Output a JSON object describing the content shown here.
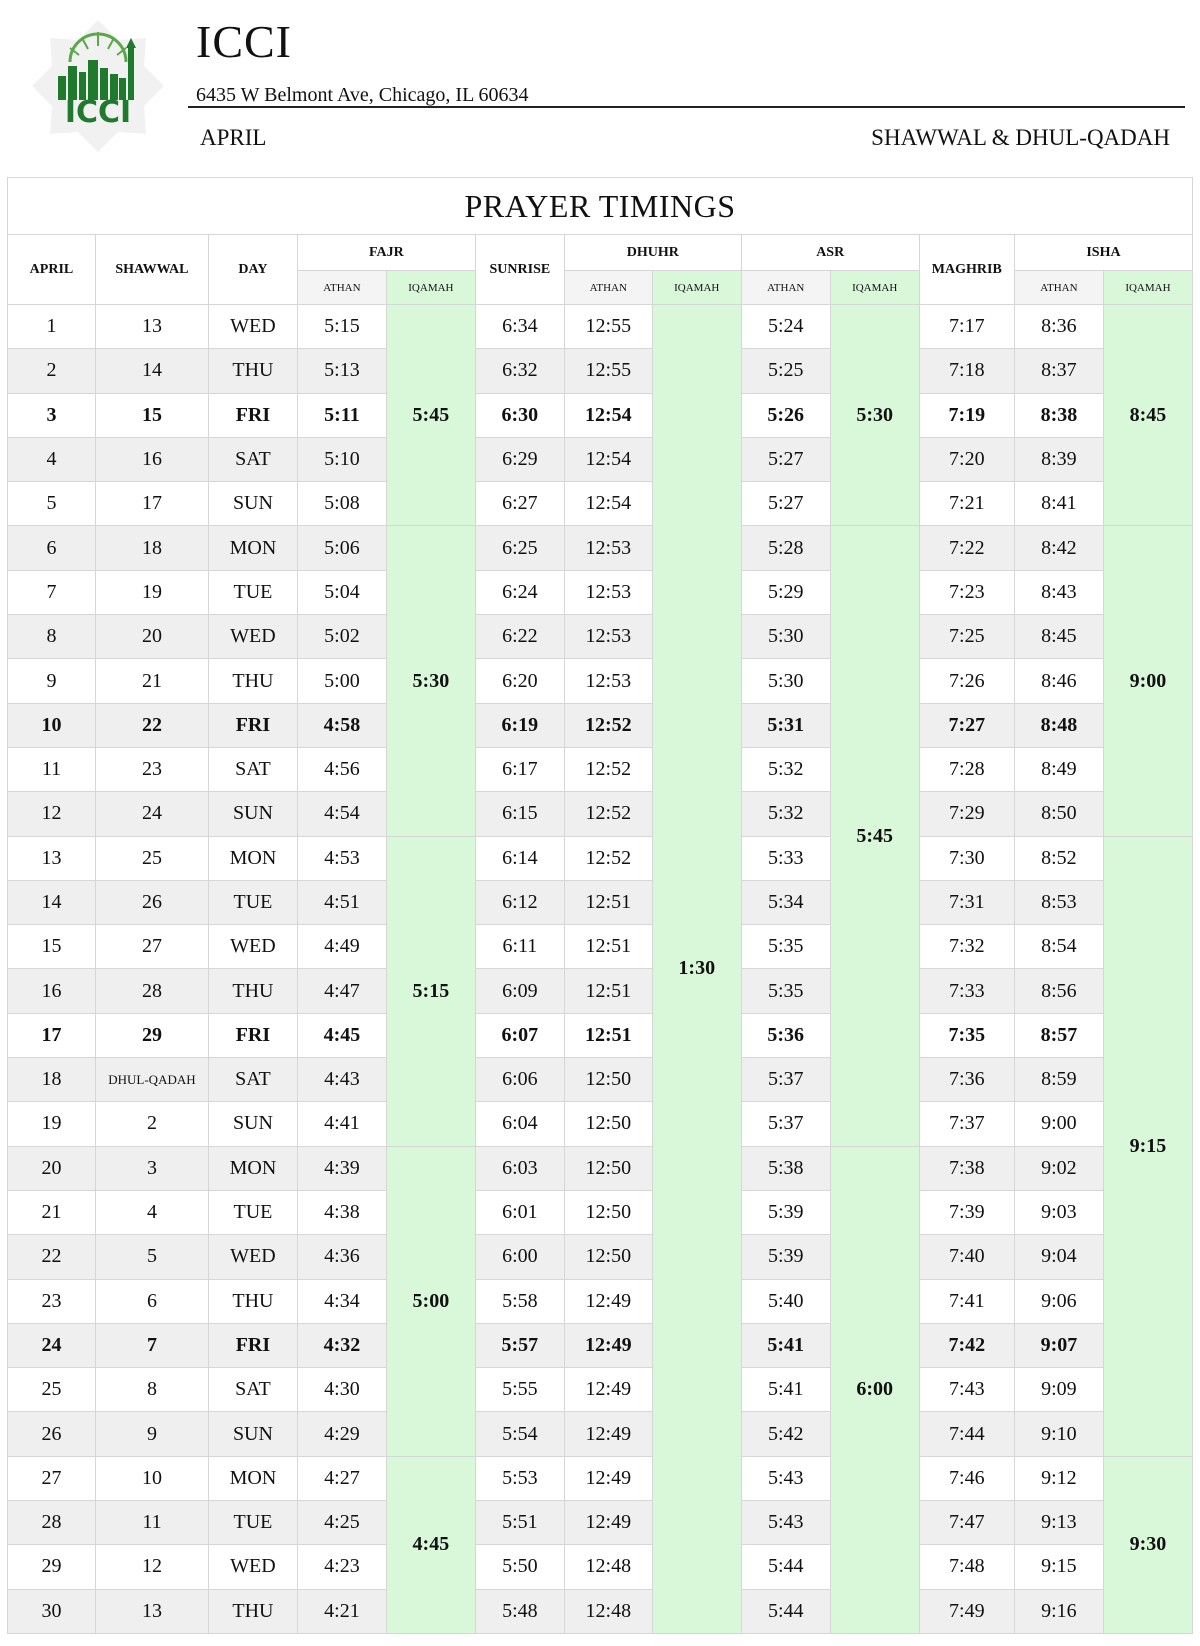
{
  "header": {
    "org": "ICCI",
    "logo_text": "ICCI",
    "address": "6435 W Belmont Ave, Chicago, IL 60634",
    "month": "APRIL",
    "hijri_months": "SHAWWAL & DHUL-QADAH"
  },
  "table": {
    "title": "PRAYER TIMINGS",
    "headers": {
      "april": "APRIL",
      "shawwal": "SHAWWAL",
      "day": "DAY",
      "fajr": "FAJR",
      "sunrise": "SUNRISE",
      "dhuhr": "DHUHR",
      "asr": "ASR",
      "maghrib": "MAGHRIB",
      "isha": "ISHA",
      "athan": "ATHAN",
      "iqamah": "IQAMAH"
    },
    "rows": [
      {
        "april": "1",
        "hijri": "13",
        "day": "WED",
        "fajr": "5:15",
        "sunrise": "6:34",
        "dhuhr": "12:55",
        "asr": "5:24",
        "maghrib": "7:17",
        "isha": "8:36"
      },
      {
        "april": "2",
        "hijri": "14",
        "day": "THU",
        "fajr": "5:13",
        "sunrise": "6:32",
        "dhuhr": "12:55",
        "asr": "5:25",
        "maghrib": "7:18",
        "isha": "8:37"
      },
      {
        "april": "3",
        "hijri": "15",
        "day": "FRI",
        "fajr": "5:11",
        "sunrise": "6:30",
        "dhuhr": "12:54",
        "asr": "5:26",
        "maghrib": "7:19",
        "isha": "8:38",
        "bold": true
      },
      {
        "april": "4",
        "hijri": "16",
        "day": "SAT",
        "fajr": "5:10",
        "sunrise": "6:29",
        "dhuhr": "12:54",
        "asr": "5:27",
        "maghrib": "7:20",
        "isha": "8:39"
      },
      {
        "april": "5",
        "hijri": "17",
        "day": "SUN",
        "fajr": "5:08",
        "sunrise": "6:27",
        "dhuhr": "12:54",
        "asr": "5:27",
        "maghrib": "7:21",
        "isha": "8:41"
      },
      {
        "april": "6",
        "hijri": "18",
        "day": "MON",
        "fajr": "5:06",
        "sunrise": "6:25",
        "dhuhr": "12:53",
        "asr": "5:28",
        "maghrib": "7:22",
        "isha": "8:42"
      },
      {
        "april": "7",
        "hijri": "19",
        "day": "TUE",
        "fajr": "5:04",
        "sunrise": "6:24",
        "dhuhr": "12:53",
        "asr": "5:29",
        "maghrib": "7:23",
        "isha": "8:43"
      },
      {
        "april": "8",
        "hijri": "20",
        "day": "WED",
        "fajr": "5:02",
        "sunrise": "6:22",
        "dhuhr": "12:53",
        "asr": "5:30",
        "maghrib": "7:25",
        "isha": "8:45"
      },
      {
        "april": "9",
        "hijri": "21",
        "day": "THU",
        "fajr": "5:00",
        "sunrise": "6:20",
        "dhuhr": "12:53",
        "asr": "5:30",
        "maghrib": "7:26",
        "isha": "8:46"
      },
      {
        "april": "10",
        "hijri": "22",
        "day": "FRI",
        "fajr": "4:58",
        "sunrise": "6:19",
        "dhuhr": "12:52",
        "asr": "5:31",
        "maghrib": "7:27",
        "isha": "8:48",
        "bold": true
      },
      {
        "april": "11",
        "hijri": "23",
        "day": "SAT",
        "fajr": "4:56",
        "sunrise": "6:17",
        "dhuhr": "12:52",
        "asr": "5:32",
        "maghrib": "7:28",
        "isha": "8:49"
      },
      {
        "april": "12",
        "hijri": "24",
        "day": "SUN",
        "fajr": "4:54",
        "sunrise": "6:15",
        "dhuhr": "12:52",
        "asr": "5:32",
        "maghrib": "7:29",
        "isha": "8:50"
      },
      {
        "april": "13",
        "hijri": "25",
        "day": "MON",
        "fajr": "4:53",
        "sunrise": "6:14",
        "dhuhr": "12:52",
        "asr": "5:33",
        "maghrib": "7:30",
        "isha": "8:52"
      },
      {
        "april": "14",
        "hijri": "26",
        "day": "TUE",
        "fajr": "4:51",
        "sunrise": "6:12",
        "dhuhr": "12:51",
        "asr": "5:34",
        "maghrib": "7:31",
        "isha": "8:53"
      },
      {
        "april": "15",
        "hijri": "27",
        "day": "WED",
        "fajr": "4:49",
        "sunrise": "6:11",
        "dhuhr": "12:51",
        "asr": "5:35",
        "maghrib": "7:32",
        "isha": "8:54"
      },
      {
        "april": "16",
        "hijri": "28",
        "day": "THU",
        "fajr": "4:47",
        "sunrise": "6:09",
        "dhuhr": "12:51",
        "asr": "5:35",
        "maghrib": "7:33",
        "isha": "8:56"
      },
      {
        "april": "17",
        "hijri": "29",
        "day": "FRI",
        "fajr": "4:45",
        "sunrise": "6:07",
        "dhuhr": "12:51",
        "asr": "5:36",
        "maghrib": "7:35",
        "isha": "8:57",
        "bold": true
      },
      {
        "april": "18",
        "hijri": "DHUL-QADAH",
        "day": "SAT",
        "fajr": "4:43",
        "sunrise": "6:06",
        "dhuhr": "12:50",
        "asr": "5:37",
        "maghrib": "7:36",
        "isha": "8:59"
      },
      {
        "april": "19",
        "hijri": "2",
        "day": "SUN",
        "fajr": "4:41",
        "sunrise": "6:04",
        "dhuhr": "12:50",
        "asr": "5:37",
        "maghrib": "7:37",
        "isha": "9:00"
      },
      {
        "april": "20",
        "hijri": "3",
        "day": "MON",
        "fajr": "4:39",
        "sunrise": "6:03",
        "dhuhr": "12:50",
        "asr": "5:38",
        "maghrib": "7:38",
        "isha": "9:02"
      },
      {
        "april": "21",
        "hijri": "4",
        "day": "TUE",
        "fajr": "4:38",
        "sunrise": "6:01",
        "dhuhr": "12:50",
        "asr": "5:39",
        "maghrib": "7:39",
        "isha": "9:03"
      },
      {
        "april": "22",
        "hijri": "5",
        "day": "WED",
        "fajr": "4:36",
        "sunrise": "6:00",
        "dhuhr": "12:50",
        "asr": "5:39",
        "maghrib": "7:40",
        "isha": "9:04"
      },
      {
        "april": "23",
        "hijri": "6",
        "day": "THU",
        "fajr": "4:34",
        "sunrise": "5:58",
        "dhuhr": "12:49",
        "asr": "5:40",
        "maghrib": "7:41",
        "isha": "9:06"
      },
      {
        "april": "24",
        "hijri": "7",
        "day": "FRI",
        "fajr": "4:32",
        "sunrise": "5:57",
        "dhuhr": "12:49",
        "asr": "5:41",
        "maghrib": "7:42",
        "isha": "9:07",
        "bold": true
      },
      {
        "april": "25",
        "hijri": "8",
        "day": "SAT",
        "fajr": "4:30",
        "sunrise": "5:55",
        "dhuhr": "12:49",
        "asr": "5:41",
        "maghrib": "7:43",
        "isha": "9:09"
      },
      {
        "april": "26",
        "hijri": "9",
        "day": "SUN",
        "fajr": "4:29",
        "sunrise": "5:54",
        "dhuhr": "12:49",
        "asr": "5:42",
        "maghrib": "7:44",
        "isha": "9:10"
      },
      {
        "april": "27",
        "hijri": "10",
        "day": "MON",
        "fajr": "4:27",
        "sunrise": "5:53",
        "dhuhr": "12:49",
        "asr": "5:43",
        "maghrib": "7:46",
        "isha": "9:12"
      },
      {
        "april": "28",
        "hijri": "11",
        "day": "TUE",
        "fajr": "4:25",
        "sunrise": "5:51",
        "dhuhr": "12:49",
        "asr": "5:43",
        "maghrib": "7:47",
        "isha": "9:13"
      },
      {
        "april": "29",
        "hijri": "12",
        "day": "WED",
        "fajr": "4:23",
        "sunrise": "5:50",
        "dhuhr": "12:48",
        "asr": "5:44",
        "maghrib": "7:48",
        "isha": "9:15"
      },
      {
        "april": "30",
        "hijri": "13",
        "day": "THU",
        "fajr": "4:21",
        "sunrise": "5:48",
        "dhuhr": "12:48",
        "asr": "5:44",
        "maghrib": "7:49",
        "isha": "9:16"
      }
    ],
    "iqamah": {
      "fajr": [
        {
          "rows": 5,
          "time": "5:45"
        },
        {
          "rows": 7,
          "time": "5:30"
        },
        {
          "rows": 7,
          "time": "5:15"
        },
        {
          "rows": 7,
          "time": "5:00"
        },
        {
          "rows": 4,
          "time": "4:45"
        }
      ],
      "dhuhr": [
        {
          "rows": 30,
          "time": "1:30"
        }
      ],
      "asr": [
        {
          "rows": 5,
          "time": "5:30"
        },
        {
          "rows": 14,
          "time": "5:45"
        },
        {
          "rows": 11,
          "time": "6:00"
        }
      ],
      "isha": [
        {
          "rows": 5,
          "time": "8:45"
        },
        {
          "rows": 7,
          "time": "9:00"
        },
        {
          "rows": 14,
          "time": "9:15"
        },
        {
          "rows": 4,
          "time": "9:30"
        }
      ]
    }
  }
}
